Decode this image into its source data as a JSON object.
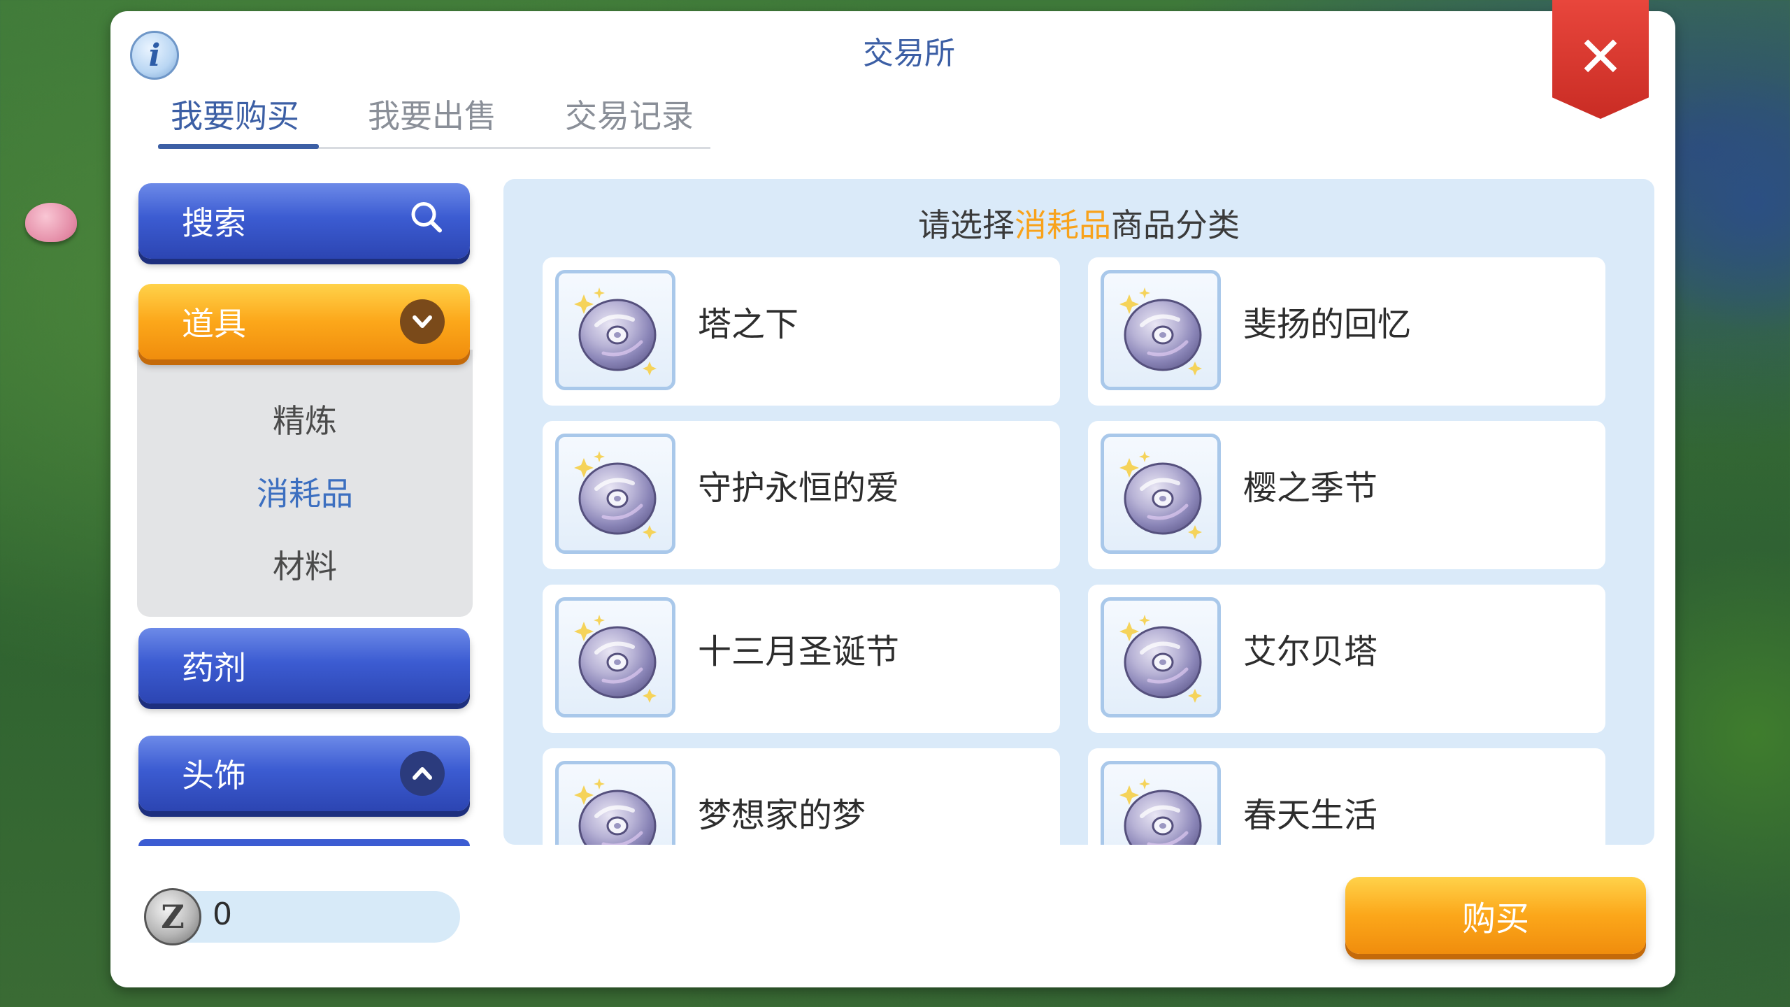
{
  "dialog": {
    "title": "交易所"
  },
  "tabs": [
    {
      "label": "我要购买",
      "active": true
    },
    {
      "label": "我要出售",
      "active": false
    },
    {
      "label": "交易记录",
      "active": false
    }
  ],
  "sidebar": {
    "search_label": "搜索",
    "categories": [
      {
        "label": "道具",
        "expanded": true,
        "subitems": [
          {
            "label": "精炼",
            "active": false
          },
          {
            "label": "消耗品",
            "active": true
          },
          {
            "label": "材料",
            "active": false
          }
        ]
      },
      {
        "label": "药剂"
      },
      {
        "label": "头饰",
        "expanded": false
      }
    ]
  },
  "content": {
    "prompt_prefix": "请选择",
    "prompt_highlight": "消耗品",
    "prompt_suffix": "商品分类",
    "items": [
      {
        "label": "塔之下",
        "icon": "music-disc-icon"
      },
      {
        "label": "斐扬的回忆",
        "icon": "music-disc-icon"
      },
      {
        "label": "守护永恒的爱",
        "icon": "music-disc-icon"
      },
      {
        "label": "樱之季节",
        "icon": "music-disc-icon"
      },
      {
        "label": "十三月圣诞节",
        "icon": "music-disc-icon"
      },
      {
        "label": "艾尔贝塔",
        "icon": "music-disc-icon"
      },
      {
        "label": "梦想家的梦",
        "icon": "music-disc-icon"
      },
      {
        "label": "春天生活",
        "icon": "music-disc-icon"
      }
    ]
  },
  "footer": {
    "zeny_symbol": "Z",
    "zeny_value": "0",
    "buy_label": "购买"
  },
  "colors": {
    "accent_blue": "#3c5fa5",
    "accent_orange": "#f8a21b",
    "close_red": "#d9362e"
  }
}
